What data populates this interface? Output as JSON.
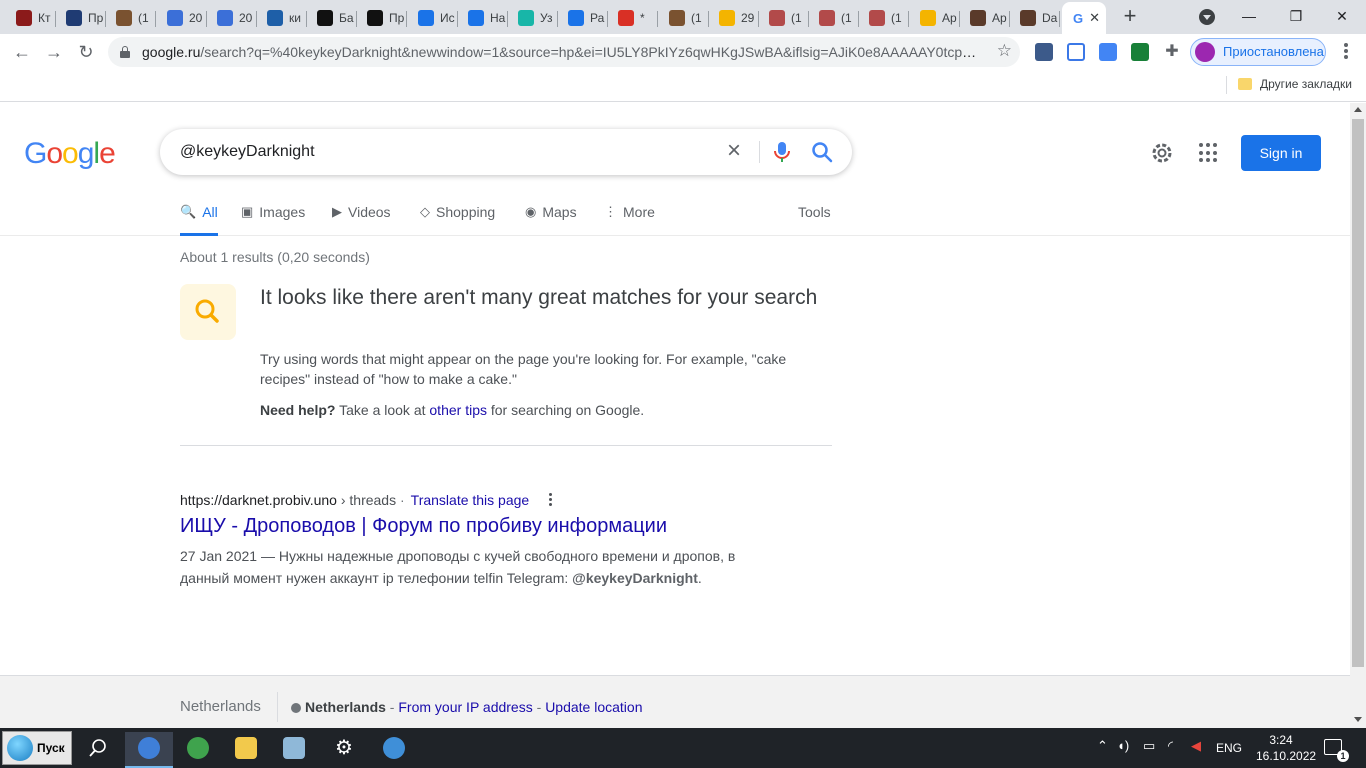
{
  "browser": {
    "tabs": [
      {
        "label": "Кт",
        "color": "#8b1a1a"
      },
      {
        "label": "Пр",
        "color": "#1f3b73"
      },
      {
        "label": "(1",
        "color": "#7a5230"
      },
      {
        "label": "20",
        "color": "#3b6fd8"
      },
      {
        "label": "20",
        "color": "#3b6fd8"
      },
      {
        "label": "ки",
        "color": "#1e5fa8"
      },
      {
        "label": "Ба",
        "color": "#111111"
      },
      {
        "label": "Пр",
        "color": "#111111"
      },
      {
        "label": "Ис",
        "color": "#1a73e8"
      },
      {
        "label": "На",
        "color": "#1a73e8"
      },
      {
        "label": "Уз",
        "color": "#18b6a8"
      },
      {
        "label": "Ра",
        "color": "#1a73e8"
      },
      {
        "label": "*",
        "color": "#d93025"
      },
      {
        "label": "(1",
        "color": "#7a5230"
      },
      {
        "label": "29",
        "color": "#f4b400"
      },
      {
        "label": "(1",
        "color": "#b24a4a"
      },
      {
        "label": "(1",
        "color": "#b24a4a"
      },
      {
        "label": "(1",
        "color": "#b24a4a"
      },
      {
        "label": "Ар",
        "color": "#f4b400"
      },
      {
        "label": "Ар",
        "color": "#5a3a2a"
      },
      {
        "label": "Da",
        "color": "#5a3a2a"
      }
    ],
    "active_tab_close": "✕",
    "new_tab": "+",
    "url_host": "google.ru",
    "url_rest": "/search?q=%40keykeyDarknight&newwindow=1&source=hp&ei=IU5LY8PkIYz6qwHKgJSwBA&iflsig=AJiK0e8AAAAAY0tcpQ-...",
    "profile_label": "Приостановлена",
    "bookmark_folder": "Другие закладки"
  },
  "search": {
    "query": "@keykeyDarknight",
    "sign_in": "Sign in",
    "tabs": [
      {
        "label": "All",
        "icon": "🔍",
        "active": true
      },
      {
        "label": "Images",
        "icon": "▣"
      },
      {
        "label": "Videos",
        "icon": "▶"
      },
      {
        "label": "Shopping",
        "icon": "◇"
      },
      {
        "label": "Maps",
        "icon": "◉"
      },
      {
        "label": "More",
        "icon": "⋮"
      }
    ],
    "tools": "Tools",
    "stats": "About 1 results (0,20 seconds)"
  },
  "tip": {
    "title": "It looks like there aren't many great matches for your search",
    "body": "Try using words that might appear on the page you're looking for. For example, \"cake recipes\" instead of \"how to make a cake.\"",
    "help_bold": "Need help?",
    "help_pre": " Take a look at ",
    "help_link": "other tips",
    "help_post": " for searching on Google."
  },
  "result": {
    "url": "https://darknet.probiv.uno",
    "crumb": " › threads",
    "translate": "Translate this page",
    "title": "ИЩУ - Дроповодов | Форум по пробиву информации",
    "snippet_pre": "27 Jan 2021 — Нужны надежные дроповоды с кучей свободного времени и дропов, в данный момент нужен аккаунт ip телефонии telfin Telegram: ",
    "snippet_bold": "@keykeyDarknight",
    "snippet_post": "."
  },
  "footer": {
    "country": "Netherlands",
    "loc_bold": "Netherlands",
    "loc_from": "From your IP address",
    "loc_update": "Update location",
    "sep": " - "
  },
  "taskbar": {
    "start": "Пуск",
    "lang": "ENG",
    "time": "3:24",
    "date": "16.10.2022",
    "notif_count": "1"
  }
}
